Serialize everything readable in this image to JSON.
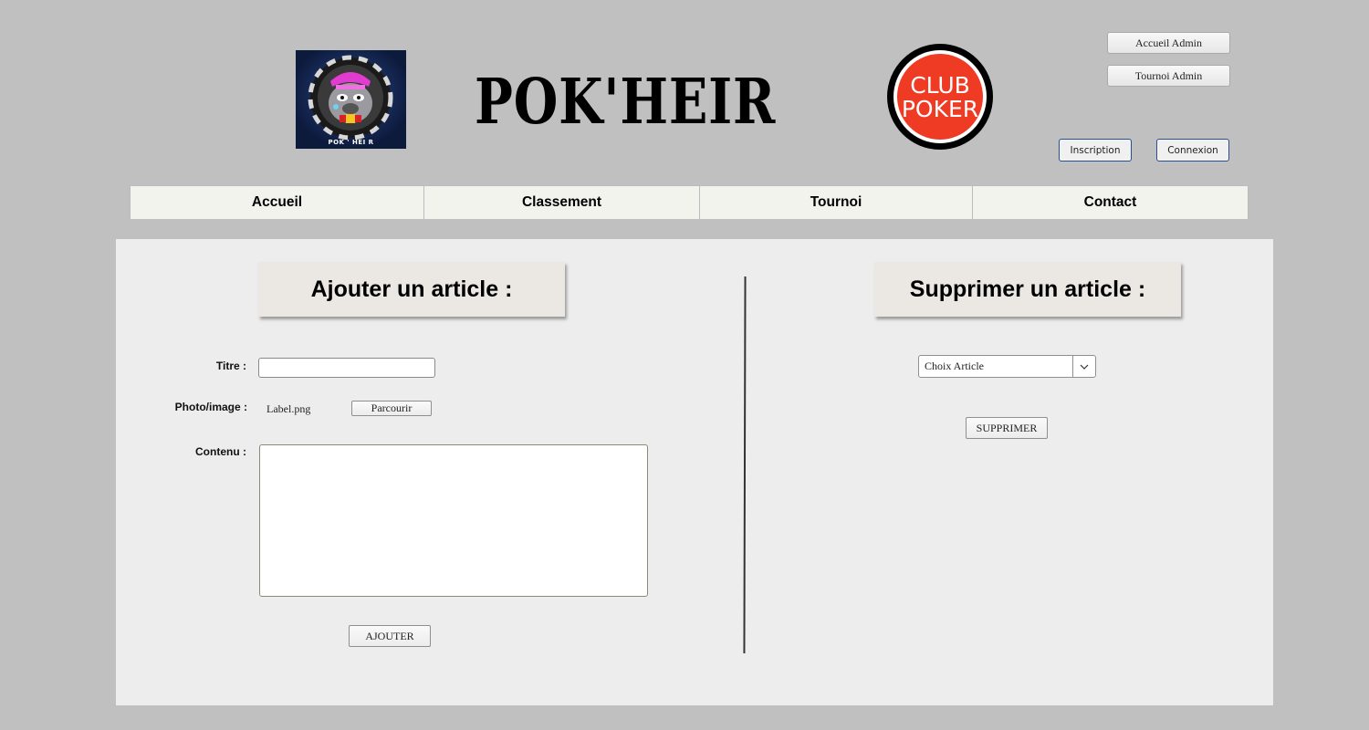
{
  "header": {
    "logo_left_text": "POK ' HEI R",
    "site_title": "POK'HEIR",
    "logo_right_line1": "CLUB",
    "logo_right_line2": "POKER",
    "admin_home_label": "Accueil Admin",
    "admin_tournament_label": "Tournoi Admin",
    "signup_label": "Inscription",
    "login_label": "Connexion"
  },
  "nav": {
    "items": [
      {
        "label": "Accueil"
      },
      {
        "label": "Classement"
      },
      {
        "label": "Tournoi"
      },
      {
        "label": "Contact"
      }
    ]
  },
  "add_article": {
    "heading": "Ajouter un article :",
    "title_label": "Titre :",
    "title_value": "",
    "image_label": "Photo/image :",
    "image_file": "Label.png",
    "browse_label": "Parcourir",
    "content_label": "Contenu :",
    "content_value": "",
    "submit_label": "AJOUTER"
  },
  "delete_article": {
    "heading": "Supprimer un article :",
    "select_value": "Choix Article",
    "submit_label": "SUPPRIMER"
  },
  "colors": {
    "page_bg": "#c0c0c0",
    "panel_bg": "#ededed",
    "nav_bg": "#f3f3ee",
    "club_logo_red": "#ef3a24"
  }
}
